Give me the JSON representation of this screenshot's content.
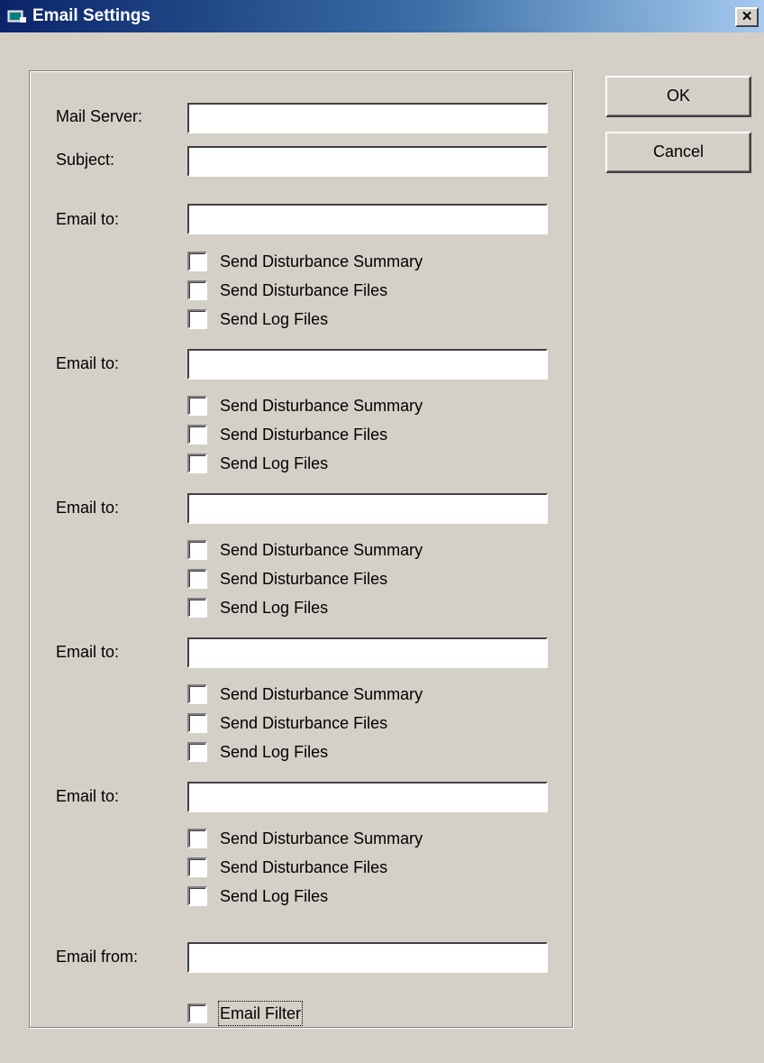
{
  "window": {
    "title": "Email Settings",
    "close_glyph": "×"
  },
  "labels": {
    "mail_server": "Mail Server:",
    "subject": "Subject:",
    "email_to": "Email to:",
    "email_from": "Email from:"
  },
  "fields": {
    "mail_server": "",
    "subject": "",
    "email_to": [
      "",
      "",
      "",
      "",
      ""
    ],
    "email_from": ""
  },
  "recipient_options": [
    {
      "send_disturbance_summary": "Send Disturbance Summary",
      "send_disturbance_files": "Send Disturbance Files",
      "send_log_files": "Send Log Files",
      "checked": [
        false,
        false,
        false
      ]
    },
    {
      "send_disturbance_summary": "Send Disturbance Summary",
      "send_disturbance_files": "Send Disturbance Files",
      "send_log_files": "Send Log Files",
      "checked": [
        false,
        false,
        false
      ]
    },
    {
      "send_disturbance_summary": "Send Disturbance Summary",
      "send_disturbance_files": "Send Disturbance Files",
      "send_log_files": "Send Log Files",
      "checked": [
        false,
        false,
        false
      ]
    },
    {
      "send_disturbance_summary": "Send Disturbance Summary",
      "send_disturbance_files": "Send Disturbance Files",
      "send_log_files": "Send Log Files",
      "checked": [
        false,
        false,
        false
      ]
    },
    {
      "send_disturbance_summary": "Send Disturbance Summary",
      "send_disturbance_files": "Send Disturbance Files",
      "send_log_files": "Send Log Files",
      "checked": [
        false,
        false,
        false
      ]
    }
  ],
  "email_filter": {
    "label": "Email Filter",
    "checked": false
  },
  "buttons": {
    "ok": "OK",
    "cancel": "Cancel"
  },
  "colors": {
    "title_start": "#0a246a",
    "title_end": "#a6caf0",
    "face": "#d4d0c8"
  },
  "icons": {
    "title": "window-app-icon",
    "close": "close-icon"
  }
}
